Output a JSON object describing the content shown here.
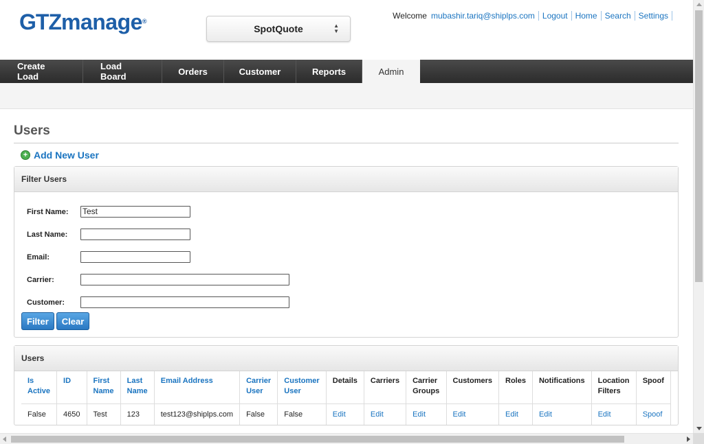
{
  "brand": {
    "logo_gtz": "GTZ",
    "logo_manage": "manage",
    "logo_reg": "®"
  },
  "app_selector": {
    "value": "SpotQuote"
  },
  "toplinks": {
    "welcome": "Welcome",
    "email": "mubashir.tariq@shiplps.com",
    "logout": "Logout",
    "home": "Home",
    "search": "Search",
    "settings": "Settings"
  },
  "nav": {
    "items": [
      {
        "label": "Create Load"
      },
      {
        "label": "Load Board"
      },
      {
        "label": "Orders"
      },
      {
        "label": "Customer"
      },
      {
        "label": "Reports"
      },
      {
        "label": "Admin"
      }
    ]
  },
  "page": {
    "title": "Users",
    "add_user": "Add New User"
  },
  "filter": {
    "heading": "Filter Users",
    "first_name_label": "First Name:",
    "first_name_value": "Test",
    "last_name_label": "Last Name:",
    "last_name_value": "",
    "email_label": "Email:",
    "email_value": "",
    "carrier_label": "Carrier:",
    "carrier_value": "",
    "customer_label": "Customer:",
    "customer_value": "",
    "filter_button": "Filter",
    "clear_button": "Clear"
  },
  "users_table": {
    "heading": "Users",
    "columns": [
      "Is Active",
      "ID",
      "First Name",
      "Last Name",
      "Email Address",
      "Carrier User",
      "Customer User",
      "Details",
      "Carriers",
      "Carrier Groups",
      "Customers",
      "Roles",
      "Notifications",
      "Location Filters",
      "Spoof"
    ],
    "rows": [
      [
        "False",
        "4650",
        "Test",
        "123",
        "test123@shiplps.com",
        "False",
        "False",
        "Edit",
        "Edit",
        "Edit",
        "Edit",
        "Edit",
        "Edit",
        "Edit",
        "Spoof"
      ]
    ]
  }
}
